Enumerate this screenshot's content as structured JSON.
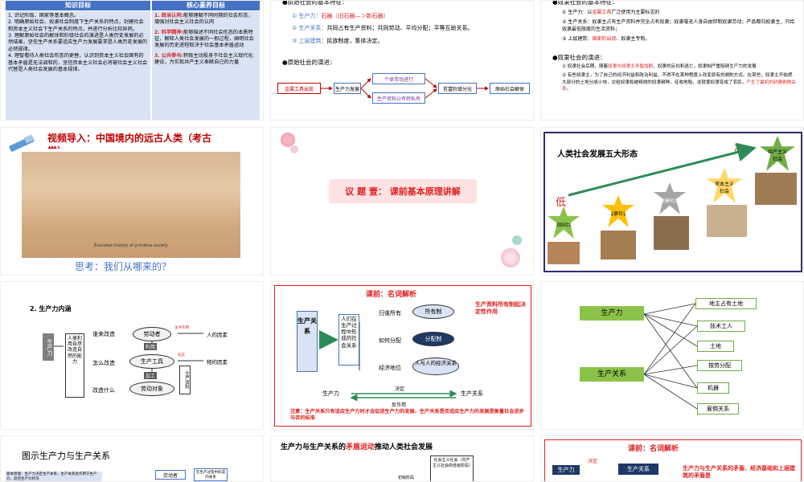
{
  "s1": {
    "hdr_left": "知识目标",
    "hdr_right": "核心素养目标",
    "left": [
      "1. 识记阶级、国家等基本概念。",
      "2. 明确原始社会、奴隶社会制度下生产关系的特点，封建社会和资本主义社会下生产关系的特点，并进行分析比较异同。",
      "3. 理解原始社会的解体和阶级社会的演进是人类历史发展的必然结果，坚信生产关系要适应生产力发展要求是人类历史发展的必然规律。",
      "4. 理智看待人类社会形态的更替，认识到资本主义社会固有的基本矛盾是无法调和的，坚信资本主义社会必将被社会主义社会代替是人类社会发展的基本规律。"
    ],
    "right": [
      {
        "tag": "1. 政治认同:",
        "text": "能够理解不同时期的社会形态，增强对社会主义社会的认同"
      },
      {
        "tag": "2. 科学精神:",
        "text": "能够描述不同社会形态的本质特征，解释人类社会发展的一般过程，阐明社会发展的历史进程取决于社会基本矛盾运动"
      },
      {
        "tag": "3. 公共参与:",
        "text": "积极主动投身于社会主义现代化建设，为实现共产主义奉献自己的力量"
      }
    ]
  },
  "s2": {
    "h1": "●原始社会的基本特征：",
    "items": [
      {
        "n": "①",
        "k": "生产力：",
        "v": "石器（旧石器—＞新石器）"
      },
      {
        "n": "②",
        "k": "生产关系：",
        "v": "共同占有生产资料；共同劳动、平均分配；平等互助关系。"
      },
      {
        "n": "③",
        "k": "上层建筑：",
        "v": "民族制度，集体决定。"
      }
    ],
    "h2": "●原始社会的演进：",
    "flow": [
      "金属工具出现",
      "生产力发展",
      "个体劳动进行",
      "生产资料公有转私有",
      "贫富阶级分化",
      "原始社会解体"
    ]
  },
  "s3": {
    "h1": "●奴隶社会的基本特征：",
    "items": [
      {
        "n": "①",
        "k": "生产力：",
        "pre": "以",
        "hl": "金属工具",
        "post": "广泛使用为主要标志的"
      },
      {
        "n": "②",
        "k": "生产关系：",
        "pre": "奴隶主占有生产资料并完全占有奴隶；奴隶毫无人身自由但制奴隶劳动；产品都归奴隶主，只给奴隶最低限度的生活资料；",
        "hl": "",
        "post": ""
      },
      {
        "n": "③",
        "k": "上层建筑：",
        "pre": "",
        "hl": "国家的出现",
        "post": "、奴隶主专制。"
      }
    ],
    "h2": "●奴隶社会的演进：",
    "evo": [
      {
        "n": "①",
        "pre": "奴隶社会后期，随着",
        "hl": "奴隶与奴隶主矛盾加剧",
        "post": "，奴隶的反抗和逃亡，奴隶制严重阻碍生产力的发展"
      },
      {
        "n": "②",
        "pre": "有些奴隶主，为了自己的经济利益和政治利益，不得不在某种程度上改变原有的剥削方式。在某些，奴隶主开始把大部分的土地分成小块，交给奴隶和被释放的奴隶耕种，征收地租，这就使奴隶变成了农民，",
        "hl": "产生了最初的封建剥削关系",
        "post": "。"
      }
    ]
  },
  "s4": {
    "title": "视频导入：中国境内的远古人类（考古学）",
    "caption": "Evolution history of primitive society",
    "question": "思考：我们从哪来的？"
  },
  "s5": {
    "title": "议 题 壹：  课前基本原理讲解"
  },
  "s6": {
    "title": "人类社会发展五大形态",
    "high": "高",
    "low": "低",
    "stages": [
      "原始社会",
      "奴隶社会",
      "封建社会",
      "资本主义社会",
      "共产主义社会"
    ]
  },
  "s7": {
    "title": "2. 生产力内涵",
    "side": "生产力",
    "vertical": "人类利用自然改造自然的能力",
    "q": [
      "谁来改造",
      "怎么改造",
      "改造什么"
    ],
    "mid": [
      "劳动者",
      "利用",
      "生产工具",
      "加工",
      "劳动对象"
    ],
    "right": [
      "人的因素",
      "物的因素"
    ],
    "tags": [
      "主导作用",
      "标志",
      "生产资料"
    ]
  },
  "s8": {
    "title": "课前：名词解析",
    "left": "生产关系",
    "def": "人们在生产过程中形成的社会关系",
    "rows": [
      {
        "k": "归谁所有",
        "v": "所有制"
      },
      {
        "k": "如何分配",
        "v": "分配制"
      },
      {
        "k": "经济地位",
        "v": "人与人的经济关系"
      }
    ],
    "note": "生产资料所有制起决定性作用",
    "bottom_left": "生产力",
    "bottom_right": "生产关系",
    "decide": "决定",
    "react": "反作用",
    "warn": "注意：生产关系只有适应生产力时才会促进生产力的发展，生产关系是否适应生产力的发展是衡量社会进步与否的标准"
  },
  "s9": {
    "a": "生产力",
    "b": "生产关系",
    "items": [
      "地主占有土地",
      "技术工人",
      "土地",
      "按劳分配",
      "机器",
      "雇佣关系"
    ]
  },
  "s10": {
    "title": "图示生产力与生产关系",
    "note": "基本原理：生产力决定生产关系，生产关系反作用于生产力，适合生产力状况",
    "b1": "劳动者",
    "b2": "在生产过程中形成的关系"
  },
  "s11": {
    "pre": "生产力与生产关系的",
    "hl": "矛盾运动",
    "post": "推动人类社会发展",
    "center": "社会主义社会（共产主义社会的低级阶段）",
    "side": "初级阶段"
  },
  "s12": {
    "title": "课前：名词解析",
    "a": "生产力",
    "b": "生产关系",
    "decide": "决定",
    "react": "反作用",
    "note": "生产力与生产关系的矛盾、经济基础和上层建筑的矛盾是"
  }
}
